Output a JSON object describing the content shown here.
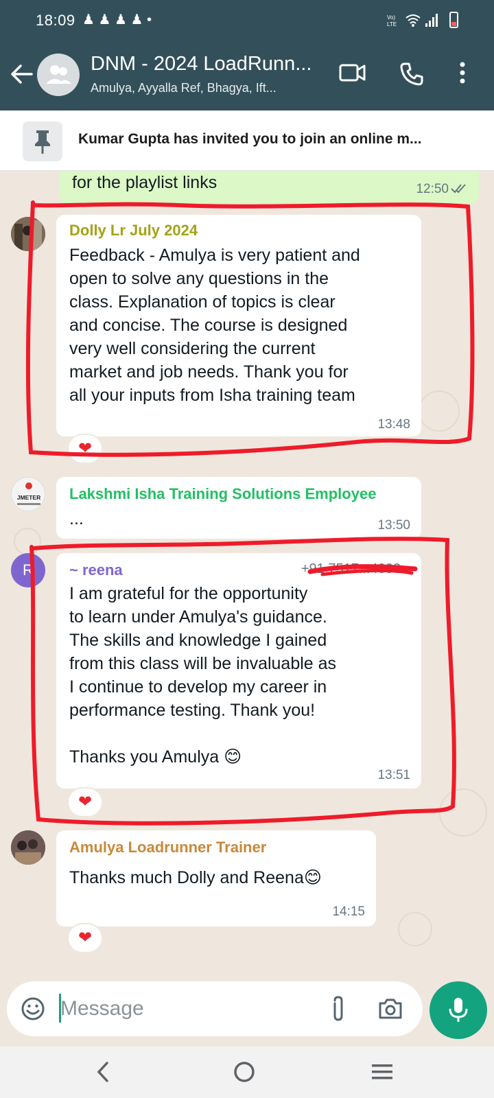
{
  "status": {
    "time": "18:09",
    "notification_icons": "♟ ♟ ♟ ♟ •",
    "network": "Vo) LTE",
    "battery_level": 0.15
  },
  "header": {
    "title": "DNM - 2024 LoadRunn...",
    "subtitle": "Amulya, Ayyalla Ref, Bhagya, Ift...",
    "icons": [
      "back-arrow-icon",
      "video-call-icon",
      "phone-call-icon",
      "more-options-icon"
    ]
  },
  "pinned": {
    "text": "Kumar Gupta has invited you to join an online m..."
  },
  "messages": [
    {
      "type": "outgoing",
      "text": "for the playlist links",
      "time": "12:50",
      "status": "read"
    },
    {
      "type": "incoming",
      "sender": "Dolly Lr July 2024",
      "sender_color": "#a3a316",
      "text": "Feedback - Amulya is very patient and\nopen to solve any questions in the\nclass. Explanation of topics is clear\nand concise. The course is designed\nvery well considering the current\nmarket and job needs. Thank you for\nall your inputs from Isha training team",
      "time": "13:48",
      "reaction": "❤"
    },
    {
      "type": "incoming",
      "sender": "Lakshmi Isha Training Solutions Employee",
      "sender_color": "#21c063",
      "avatar_text": "JMETER",
      "text": "...",
      "time": "13:50"
    },
    {
      "type": "incoming",
      "sender": "~ reena",
      "sender_color": "#7f66cf",
      "phone": "+91 7517...4003",
      "avatar_letter": "R",
      "text": "I am grateful for the opportunity\nto learn under Amulya's guidance.\nThe skills and knowledge I gained\nfrom this class will be invaluable as\nI continue to develop my career in\nperformance testing. Thank you!\n\nThanks you Amulya 😊",
      "time": "13:51",
      "reaction": "❤"
    },
    {
      "type": "incoming",
      "sender": "Amulya Loadrunner Trainer",
      "sender_color": "#c8893a",
      "text": "Thanks much Dolly and Reena😊",
      "time": "14:15",
      "reaction": "❤"
    }
  ],
  "input": {
    "placeholder": "Message",
    "icons": [
      "emoji-icon",
      "attach-icon",
      "camera-icon",
      "mic-icon"
    ]
  },
  "navigation": {
    "icons": [
      "nav-back-icon",
      "nav-home-icon",
      "nav-recents-icon"
    ]
  },
  "colors": {
    "header_bg": "#33505a",
    "chat_bg": "#efe7dd",
    "outgoing_bg": "#dcf8c6",
    "accent": "#14a37f",
    "highlight_marker": "#ef1b2a"
  }
}
